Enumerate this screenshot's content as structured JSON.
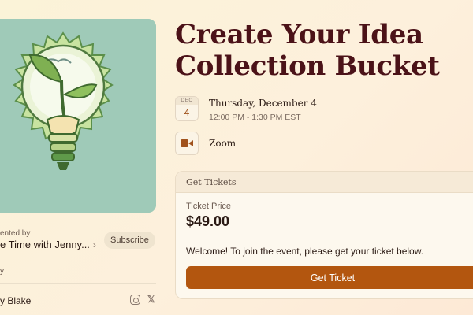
{
  "event": {
    "title": "Create Your Idea Collection Bucket",
    "date_badge": {
      "month": "DEC",
      "day": "4"
    },
    "date": "Thursday, December 4",
    "time": "12:00 PM - 1:30 PM EST",
    "location": "Zoom"
  },
  "sidebar": {
    "presented_by_label": "ented by",
    "host_name": "e Time with Jenny...",
    "subscribe_label": "Subscribe",
    "hosted_by_label": "y",
    "host_person": "y Blake",
    "social_icons": [
      "instagram-icon",
      "x-icon"
    ],
    "x_glyph": "𝕏"
  },
  "tickets": {
    "header": "Get Tickets",
    "price_label": "Ticket Price",
    "price": "$49.00",
    "message": "Welcome! To join the event, please get your ticket below.",
    "button_label": "Get Ticket"
  },
  "colors": {
    "accent": "#b3560f",
    "title": "#4b1218",
    "background": "#fbf3d8",
    "cover_background": "#9fcab8"
  }
}
